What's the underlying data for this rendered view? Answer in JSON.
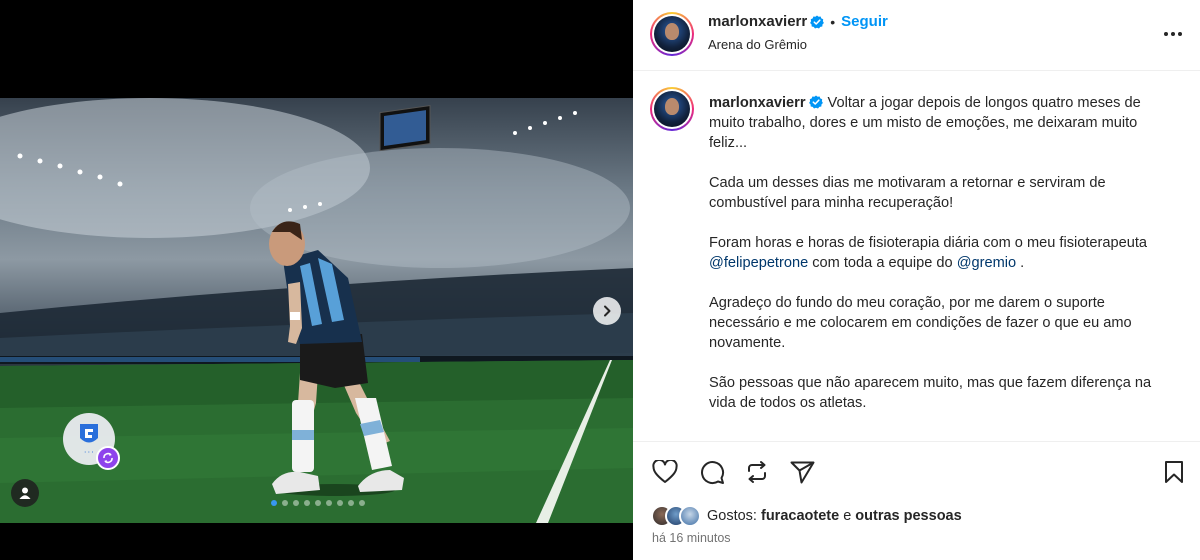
{
  "header": {
    "username": "marlonxavierr",
    "follow_label": "Seguir",
    "separator": "•",
    "location": "Arena do Grêmio"
  },
  "caption": {
    "username": "marlonxavierr",
    "p1": "Voltar a jogar depois de longos quatro meses de muito trabalho, dores e um misto de emoções, me deixaram muito feliz...",
    "p2": "Cada um desses dias me motivaram a retornar e serviram de combustível para minha recuperação!",
    "p3_a": "Foram horas e horas de fisioterapia diária com o meu fisioterapeuta ",
    "p3_mention1": "@felipepetrone",
    "p3_b": " com toda a equipe do ",
    "p3_mention2": "@gremio",
    "p3_c": " .",
    "p4": "Agradeço do fundo do meu coração, por me darem o suporte necessário e me colocarem em condições de fazer o que eu amo novamente.",
    "p5": "São pessoas que não aparecem muito, mas que fazem diferença na vida de todos os atletas."
  },
  "likes": {
    "prefix": "Gostos: ",
    "user": "furacaotete",
    "middle": " e ",
    "others": "outras pessoas"
  },
  "timestamp": "há 16 minutos",
  "carousel": {
    "total": 9,
    "active_index": 0
  },
  "icons": {
    "next": "chevron-right-icon",
    "tag": "user-icon",
    "like": "heart-icon",
    "comment": "comment-icon",
    "repost": "repost-icon",
    "share": "send-icon",
    "save": "bookmark-icon",
    "more": "more-icon",
    "verified": "verified-badge-icon"
  },
  "colors": {
    "accent": "#0095f6",
    "verified": "#0095f6",
    "mention": "#00376b",
    "muted": "#737373"
  }
}
